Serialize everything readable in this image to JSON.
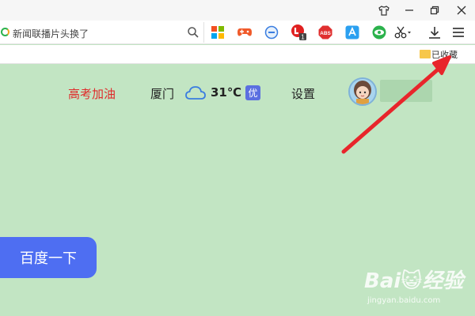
{
  "window_controls": [
    {
      "name": "skin-icon",
      "glyph": "👕"
    },
    {
      "name": "minimize-icon",
      "glyph": "—"
    },
    {
      "name": "restore-icon",
      "glyph": "❐"
    },
    {
      "name": "close-icon",
      "glyph": "✕"
    }
  ],
  "search": {
    "placeholder": "新闻联播片头换了"
  },
  "extensions": [
    {
      "name": "apps-grid-icon",
      "color": "#f2a530"
    },
    {
      "name": "game-controller-icon",
      "color": "#f05a2a"
    },
    {
      "name": "minus-circle-icon",
      "color": "#3a7de0"
    },
    {
      "name": "notification-icon",
      "color": "#e02020",
      "badge": "1"
    },
    {
      "name": "adblock-icon",
      "color": "#e03030",
      "text": "ABS"
    },
    {
      "name": "translate-icon",
      "color": "#2ba0f0"
    },
    {
      "name": "eye-icon",
      "color": "#2bb24c"
    },
    {
      "name": "scissors-icon",
      "color": "#333333"
    },
    {
      "name": "download-icon",
      "color": "#333333"
    },
    {
      "name": "menu-icon",
      "color": "#333333"
    }
  ],
  "bookmarks": {
    "label": "已收藏"
  },
  "header": {
    "gaokao": "高考加油",
    "city": "厦门",
    "temperature": "31℃",
    "air_quality": "优",
    "settings": "设置"
  },
  "search_button": {
    "label": "百度一下"
  },
  "watermark": {
    "brand": "Bai😺经验",
    "url": "jingyan.baidu.com"
  },
  "colors": {
    "page_bg": "#c2e5c3",
    "accent_blue": "#4e6ef2",
    "arrow_red": "#e8252b"
  }
}
